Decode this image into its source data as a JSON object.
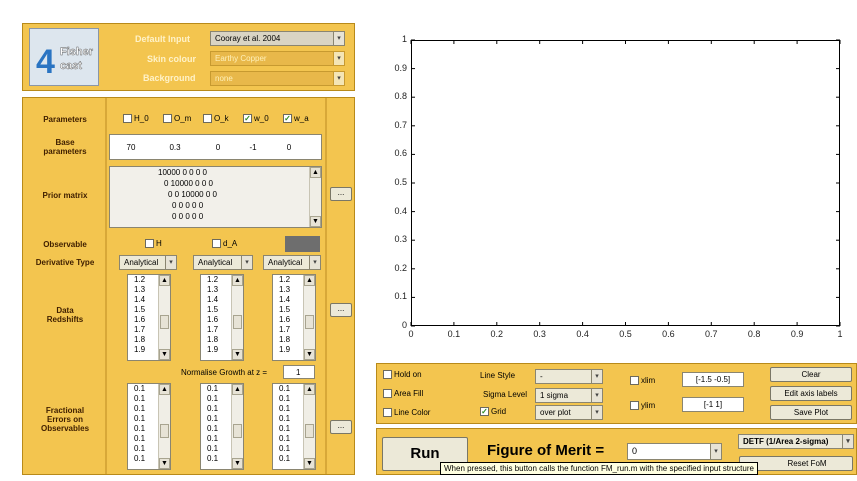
{
  "header": {
    "logo_text": "Fisher cast",
    "default_input_label": "Default Input",
    "default_input_value": "Cooray et al. 2004",
    "skin_label": "Skin colour",
    "skin_value": "Earthy Copper",
    "background_label": "Background",
    "background_value": "none"
  },
  "params": {
    "parameters_label": "Parameters",
    "checkboxes": [
      {
        "label": "H_0",
        "checked": false
      },
      {
        "label": "O_m",
        "checked": false
      },
      {
        "label": "O_k",
        "checked": false
      },
      {
        "label": "w_0",
        "checked": true
      },
      {
        "label": "w_a",
        "checked": true
      }
    ],
    "base_label": "Base parameters",
    "base_values": [
      "70",
      "0.3",
      "0",
      "-1",
      "0"
    ],
    "prior_label": "Prior matrix",
    "prior_rows": [
      "10000   0   0   0   0",
      "0 10000   0   0   0",
      "0   0 10000   0   0",
      "0   0   0   0   0",
      "0   0   0   0   0"
    ],
    "observable_label": "Observable",
    "obs_checkboxes": [
      {
        "label": "H",
        "checked": false
      },
      {
        "label": "d_A",
        "checked": false
      }
    ],
    "deriv_label": "Derivative Type",
    "deriv_values": [
      "Analytical",
      "Analytical",
      "Analytical"
    ],
    "data_label": "Data Redshifts",
    "redshifts": [
      "1.2",
      "1.3",
      "1.4",
      "1.5",
      "1.6",
      "1.7",
      "1.8",
      "1.9"
    ],
    "normalise_label": "Normalise Growth at z =",
    "normalise_value": "1",
    "errors_label": "Fractional Errors on Observables",
    "errors": [
      "0.1",
      "0.1",
      "0.1",
      "0.1",
      "0.1",
      "0.1",
      "0.1",
      "0.1"
    ],
    "dots_button": "...",
    "scroll_up": "▲",
    "scroll_down": "▼",
    "dropdown_arrow": "▾"
  },
  "plot": {
    "y_ticks": [
      "0",
      "0.1",
      "0.2",
      "0.3",
      "0.4",
      "0.5",
      "0.6",
      "0.7",
      "0.8",
      "0.9",
      "1"
    ],
    "x_ticks": [
      "0",
      "0.1",
      "0.2",
      "0.3",
      "0.4",
      "0.5",
      "0.6",
      "0.7",
      "0.8",
      "0.9",
      "1"
    ]
  },
  "controls": {
    "hold_on": "Hold on",
    "area_fill": "Area Fill",
    "line_color": "Line Color",
    "line_style_label": "Line Style",
    "line_style_value": "-",
    "sigma_label": "Sigma Level",
    "sigma_value": "1 sigma",
    "grid_label": "Grid",
    "grid_checked": true,
    "grid_pos_value": "over plot",
    "xlim_label": "xlim",
    "xlim_value": "[-1.5 -0.5]",
    "ylim_label": "ylim",
    "ylim_value": "[-1 1]",
    "clear_button": "Clear",
    "edit_axis_button": "Edit axis labels",
    "save_plot_button": "Save Plot"
  },
  "run": {
    "run_button": "Run",
    "fom_label": "Figure of Merit  =",
    "fom_value": "0",
    "detf_value": "DETF (1/Area 2-sigma)",
    "reset_button": "Reset FoM",
    "tooltip": "When pressed, this button calls the function FM_run.m with the specified input structure"
  },
  "colors": {
    "panel": "#f3c54f",
    "panel_border": "#b88a1a",
    "label": "#402000"
  }
}
